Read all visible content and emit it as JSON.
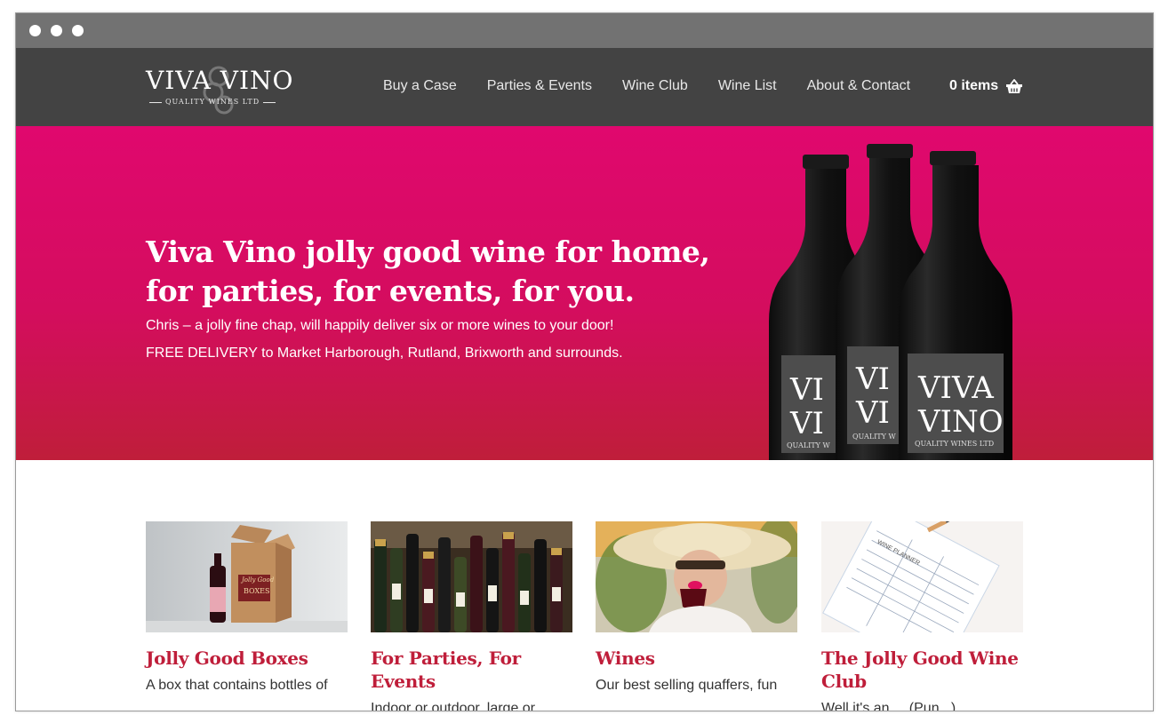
{
  "brand": {
    "name": "Viva Vino",
    "logo_main": "VIVA VINO",
    "logo_sub": "QUALITY WINES LTD"
  },
  "nav": {
    "items": [
      {
        "label": "Buy a Case"
      },
      {
        "label": "Parties & Events"
      },
      {
        "label": "Wine Club"
      },
      {
        "label": "Wine List"
      },
      {
        "label": "About & Contact"
      }
    ],
    "cart_label": "0 items",
    "cart_icon": "basket-icon"
  },
  "hero": {
    "title": "Viva Vino jolly good wine for home, for parties, for events, for you.",
    "line1": "Chris – a jolly fine chap, will happily deliver six or more wines to your door!",
    "line2": "FREE DELIVERY to Market Harborough, Rutland, Brixworth and surrounds.",
    "bottle_label_main": "VIVA VINO",
    "bottle_label_sub": "QUALITY WINES LTD"
  },
  "cards": [
    {
      "title": "Jolly Good Boxes",
      "text": "A box that contains bottles of",
      "box_label_top": "Jolly Good",
      "box_label": "BOXES"
    },
    {
      "title": "For Parties, For Events",
      "text": "Indoor or outdoor, large or"
    },
    {
      "title": "Wines",
      "text": "Our best selling quaffers, fun"
    },
    {
      "title": "The Jolly Good Wine Club",
      "text": "Well it's an ... (Pun...)",
      "planner_label": "WINE PLANNER"
    }
  ],
  "colors": {
    "nav_bg": "#434343",
    "chrome_bg": "#727272",
    "hero_top": "#e0086e",
    "hero_bottom": "#bf1e3a",
    "accent": "#bf1e3a"
  }
}
